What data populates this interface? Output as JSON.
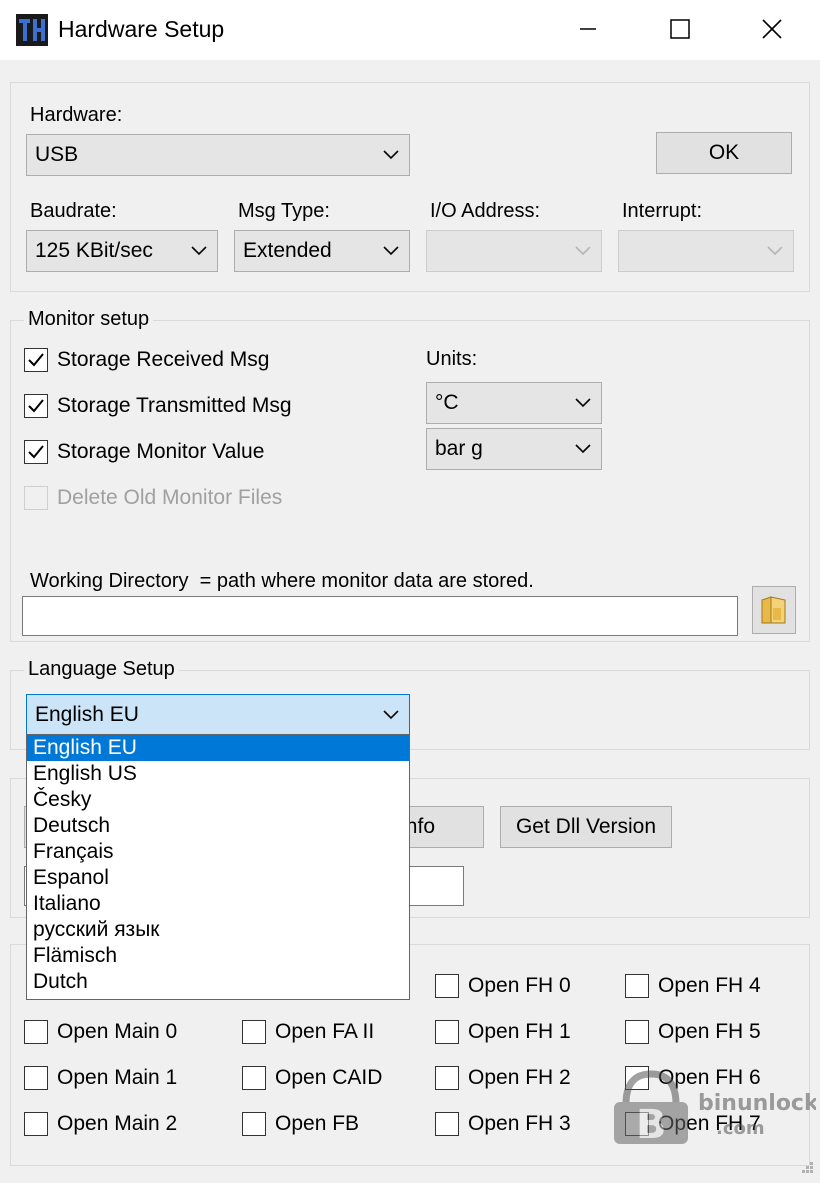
{
  "window": {
    "title": "Hardware Setup",
    "minimize": "minimize",
    "maximize": "maximize",
    "close": "close"
  },
  "hardware": {
    "label": "Hardware:",
    "value": "USB",
    "ok": "OK",
    "baudrate_label": "Baudrate:",
    "baudrate_value": "125 KBit/sec",
    "msgtype_label": "Msg Type:",
    "msgtype_value": "Extended",
    "io_label": "I/O Address:",
    "io_value": "",
    "interrupt_label": "Interrupt:",
    "interrupt_value": ""
  },
  "monitor": {
    "group_label": "Monitor setup",
    "checks": [
      {
        "label": "Storage Received Msg",
        "checked": true,
        "enabled": true
      },
      {
        "label": "Storage Transmitted Msg",
        "checked": true,
        "enabled": true
      },
      {
        "label": "Storage Monitor Value",
        "checked": true,
        "enabled": true
      },
      {
        "label": "Delete Old Monitor Files",
        "checked": false,
        "enabled": false
      }
    ],
    "units_label": "Units:",
    "unit_temp": "°C",
    "unit_pressure": "bar g",
    "workdir_label": "Working Directory  = path where monitor data are stored.",
    "workdir_value": ""
  },
  "language": {
    "group_label": "Language Setup",
    "selected": "English EU",
    "options": [
      "English EU",
      "English US",
      "Česky",
      "Deutsch",
      "Français",
      "Espanol",
      "Italiano",
      "русский язык",
      "Flämisch",
      "Dutch"
    ]
  },
  "info": {
    "info_button": "Info",
    "dll_button": "Get Dll Version",
    "field_value": ""
  },
  "opens": {
    "col1": [
      "Open Main 0",
      "Open Main 1",
      "Open Main 2"
    ],
    "col2": [
      "Open FA II",
      "Open CAID",
      "Open FB"
    ],
    "col3": [
      "Open FH 0",
      "Open FH 1",
      "Open FH 2",
      "Open FH 3"
    ],
    "col4": [
      "Open FH 4",
      "Open FH 5",
      "Open FH 6",
      "Open FH 7"
    ]
  },
  "watermark": "binunlock.com"
}
